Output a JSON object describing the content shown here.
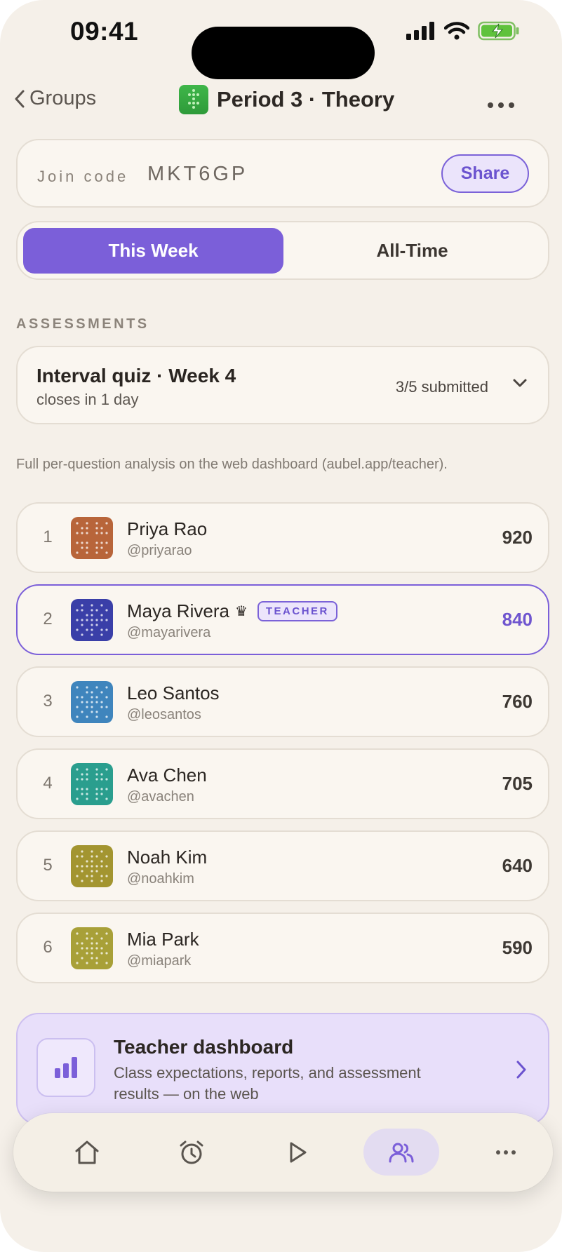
{
  "status_bar": {
    "time": "09:41"
  },
  "nav": {
    "back_label": "Groups",
    "title": "Period 3 · Theory"
  },
  "join": {
    "label": "Join code",
    "code": "MKT6GP",
    "share_label": "Share"
  },
  "segments": {
    "active": "This Week",
    "inactive": "All-Time"
  },
  "section_label": "ASSESSMENTS",
  "assessment": {
    "title": "Interval quiz · Week 4",
    "subtitle": "closes in 1 day",
    "submitted": "3/5 submitted"
  },
  "note": "Full per-question analysis on the web dashboard (aubel.app/teacher).",
  "leaderboard": [
    {
      "rank": "1",
      "name": "Priya Rao",
      "handle": "@priyarao",
      "score": "920",
      "avatar_color": "#b8653a"
    },
    {
      "rank": "2",
      "name": "Maya Rivera",
      "handle": "@mayarivera",
      "score": "840",
      "avatar_color": "#3a3fa8",
      "crown": "♛",
      "badge": "TEACHER"
    },
    {
      "rank": "3",
      "name": "Leo Santos",
      "handle": "@leosantos",
      "score": "760",
      "avatar_color": "#3f85bd"
    },
    {
      "rank": "4",
      "name": "Ava Chen",
      "handle": "@avachen",
      "score": "705",
      "avatar_color": "#2a9e8e"
    },
    {
      "rank": "5",
      "name": "Noah Kim",
      "handle": "@noahkim",
      "score": "640",
      "avatar_color": "#a39530"
    },
    {
      "rank": "6",
      "name": "Mia Park",
      "handle": "@miapark",
      "score": "590",
      "avatar_color": "#a8a038"
    }
  ],
  "dashboard": {
    "title": "Teacher dashboard",
    "description": "Class expectations, reports, and assessment results — on the web"
  },
  "tabbar": {
    "tabs": [
      "home-icon",
      "alarm-icon",
      "play-icon",
      "groups-icon",
      "more-icon"
    ],
    "active_tab": "groups-icon"
  },
  "colors": {
    "accent": "#7b5fd9",
    "background": "#f5f0e9",
    "card": "#faf6f0"
  }
}
